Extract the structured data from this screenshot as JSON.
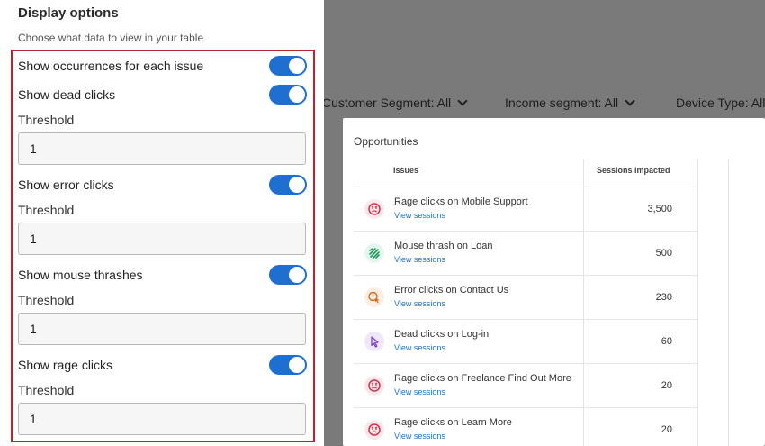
{
  "panel": {
    "title": "Display options",
    "subtitle": "Choose what data to view in your table",
    "options": [
      {
        "label": "Show occurrences for each issue",
        "enabled": true
      },
      {
        "label": "Show dead clicks",
        "enabled": true,
        "threshold_label": "Threshold",
        "threshold": "1"
      },
      {
        "label": "Show error clicks",
        "enabled": true,
        "threshold_label": "Threshold",
        "threshold": "1"
      },
      {
        "label": "Show mouse thrashes",
        "enabled": true,
        "threshold_label": "Threshold",
        "threshold": "1"
      },
      {
        "label": "Show rage clicks",
        "enabled": true,
        "threshold_label": "Threshold",
        "threshold": "1"
      }
    ]
  },
  "filters": [
    {
      "label": "Customer Segment: All"
    },
    {
      "label": "Income segment: All"
    },
    {
      "label": "Device Type: All"
    }
  ],
  "card": {
    "title": "Opportunities",
    "columns": [
      "Issues",
      "Sessions impacted"
    ],
    "rows": [
      {
        "icon": "rage-click-icon",
        "issue": "Rage clicks on Mobile Support",
        "link": "View sessions",
        "sessions": "3,500"
      },
      {
        "icon": "mouse-thrash-icon",
        "issue": "Mouse thrash on Loan",
        "link": "View sessions",
        "sessions": "500"
      },
      {
        "icon": "error-click-icon",
        "issue": "Error clicks on Contact Us",
        "link": "View sessions",
        "sessions": "230"
      },
      {
        "icon": "dead-click-icon",
        "issue": "Dead clicks on Log-in",
        "link": "View sessions",
        "sessions": "60"
      },
      {
        "icon": "rage-click-icon",
        "issue": "Rage clicks on Freelance Find Out More",
        "link": "View sessions",
        "sessions": "20"
      },
      {
        "icon": "rage-click-icon",
        "issue": "Rage clicks on Learn More",
        "link": "View sessions",
        "sessions": "20"
      }
    ]
  },
  "colors": {
    "toggle_on": "#1f6fd0",
    "highlight_border": "#b8232f",
    "link": "#1a73c8",
    "backdrop": "#7a7a7a"
  }
}
